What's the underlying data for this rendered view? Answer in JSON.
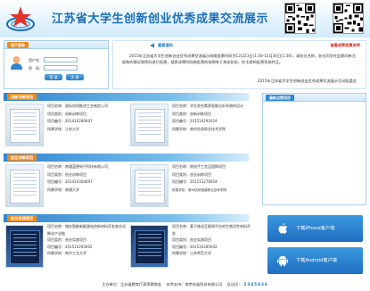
{
  "header": {
    "title": "江苏省大学生创新创业优秀成果交流展示"
  },
  "login": {
    "tab": "用户登录",
    "username_label": "用户名：",
    "password_label": "密　码：",
    "login_button": "登 录",
    "register_button": "注 册"
  },
  "notice": {
    "title": "重要通知",
    "link": "查看成果投票说明",
    "body": "2015年江苏省大学生创新创业优秀成果交流展示网络投票时间为12月23日(1:30-12月30日(1:30)，请各位名称，各位同学在此期间有注册和的情况和密码进行投票，搜索成果时网络投票的前期关于关闭状态，你主席的投票系统并且。",
    "sign": "2015年江苏省大学生创新创业优秀成果交流展示活动组委会"
  },
  "recommend": {
    "tab": "最新点赞项目"
  },
  "sections": [
    {
      "label": "创新训练项目",
      "items": [
        {
          "name": "项目名称：国际协同推进工艺制造公司",
          "type": "项目类别：创新训练项目",
          "id": "项目编号：201410289007",
          "school": "所属学校：江苏大学"
        },
        {
          "name": "项目名称：学生综合素养智能分析系统的设计",
          "type": "项目类别：创新训练项目",
          "id": "项目编号：201510291024",
          "school": "所属学校：南京信息职业技术学院"
        }
      ]
    },
    {
      "label": "创业训练项目",
      "items": [
        {
          "name": "项目名称：南通蓝德电子科技有限公司",
          "type": "项目类别：创业训练项目",
          "id": "项目编号：201410304097",
          "school": "所属学校：南通大学"
        },
        {
          "name": "项目名称：原创手工艺品团购项目",
          "type": "项目类别：创业训练项目",
          "id": "项目编号：201511276054",
          "school": "所属学校：常州纺织服装职业技术学院"
        }
      ]
    },
    {
      "label": "创业实践项目",
      "items": [
        {
          "name": "项目名称：储存智能新能源电池新材料开发商业化孵化产业链",
          "type": "项目类别：创业实践项目",
          "id": "项目编号：201510293002",
          "school": "所属学校：南京工业大学"
        },
        {
          "name": "项目名称：基于移动互联网平台的生物活性材料开发",
          "type": "项目类别：创业实践项目",
          "id": "项目编号：201510285002",
          "school": "所属学校：江苏师范大学"
        }
      ]
    }
  ],
  "downloads": {
    "iphone": "下载iPhone客户端",
    "android": "下载Android客户端"
  },
  "footer": {
    "organizer": "主办单位：江苏省教育厅高等教育处",
    "support": "技术支持：南京先极科技有限公司",
    "counter_label": "总访问：",
    "counter": "2345836"
  },
  "colors": {
    "brand_blue": "#1c70b6",
    "accent_orange": "#f08a1c",
    "alert_red": "#d0302a"
  }
}
